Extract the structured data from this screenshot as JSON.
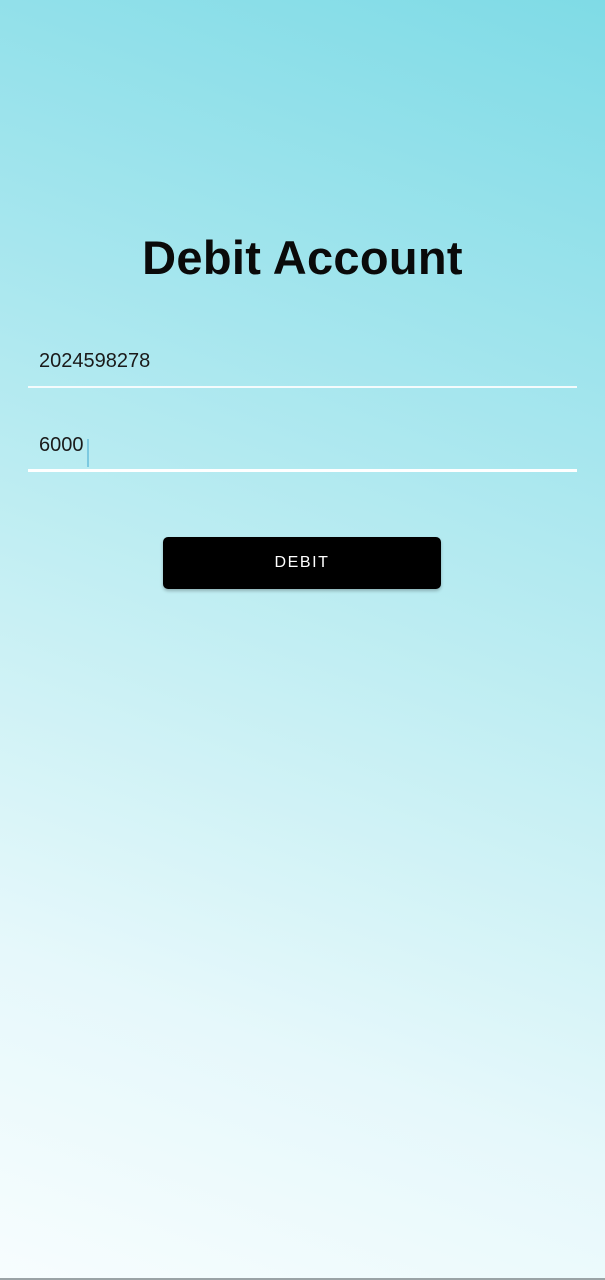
{
  "header": {
    "title": "Debit Account"
  },
  "form": {
    "account_number": {
      "value": "2024598278"
    },
    "amount": {
      "value": "6000"
    },
    "submit_label": "DEBIT"
  },
  "colors": {
    "background_top": "#7fdbe6",
    "background_bottom": "#f7fdfe",
    "button_bg": "#000000",
    "button_text": "#ffffff",
    "caret": "#7cc9e0"
  }
}
